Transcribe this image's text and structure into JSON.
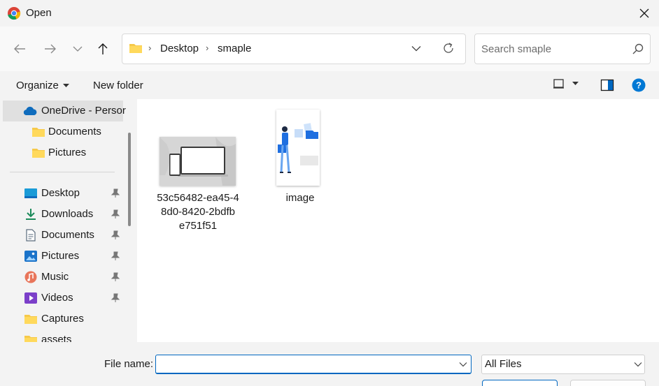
{
  "window": {
    "title": "Open"
  },
  "address": {
    "segments": [
      "Desktop",
      "smaple"
    ]
  },
  "search": {
    "placeholder": "Search smaple"
  },
  "toolbar": {
    "organize_label": "Organize",
    "new_folder_label": "New folder"
  },
  "sidebar": {
    "onedrive": "OneDrive - Persor",
    "onedrive_children": [
      "Documents",
      "Pictures"
    ],
    "quick_access": [
      {
        "label": "Desktop",
        "icon": "desktop-icon",
        "pinned": true
      },
      {
        "label": "Downloads",
        "icon": "downloads-icon",
        "pinned": true
      },
      {
        "label": "Documents",
        "icon": "documents-icon",
        "pinned": true
      },
      {
        "label": "Pictures",
        "icon": "pictures-icon",
        "pinned": true
      },
      {
        "label": "Music",
        "icon": "music-icon",
        "pinned": true
      },
      {
        "label": "Videos",
        "icon": "videos-icon",
        "pinned": true
      },
      {
        "label": "Captures",
        "icon": "folder-icon",
        "pinned": false
      },
      {
        "label": "assets",
        "icon": "folder-icon",
        "pinned": false
      }
    ]
  },
  "files": [
    {
      "name_lines": [
        "53c56482-ea45-4",
        "8d0-8420-2bdfb",
        "e751f51"
      ],
      "thumb": "laptop-image"
    },
    {
      "name_lines": [
        "image"
      ],
      "thumb": "illustration-image"
    }
  ],
  "footer": {
    "file_name_label": "File name:",
    "file_name_value": "",
    "filter_value": "All Files"
  },
  "colors": {
    "accent": "#0067c0",
    "folder": "#f6c94a",
    "help": "#0078d4"
  }
}
